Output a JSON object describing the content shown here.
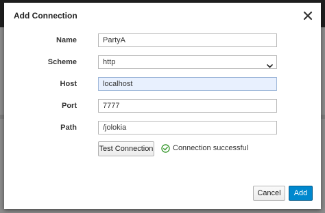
{
  "dialog": {
    "title": "Add Connection",
    "close_icon": "close-icon"
  },
  "form": {
    "name": {
      "label": "Name",
      "value": "PartyA"
    },
    "scheme": {
      "label": "Scheme",
      "value": "http",
      "icon": "chevron-down-icon"
    },
    "host": {
      "label": "Host",
      "value": "localhost"
    },
    "port": {
      "label": "Port",
      "value": "7777"
    },
    "path": {
      "label": "Path",
      "value": "/jolokia"
    }
  },
  "test": {
    "button_label": "Test Connection",
    "status_text": "Connection successful",
    "status_icon": "check-circle-icon",
    "status_color": "#3f9c35"
  },
  "footer": {
    "cancel_label": "Cancel",
    "add_label": "Add"
  },
  "colors": {
    "primary": "#0088ce",
    "autofill_bg": "#e8f0fe"
  }
}
